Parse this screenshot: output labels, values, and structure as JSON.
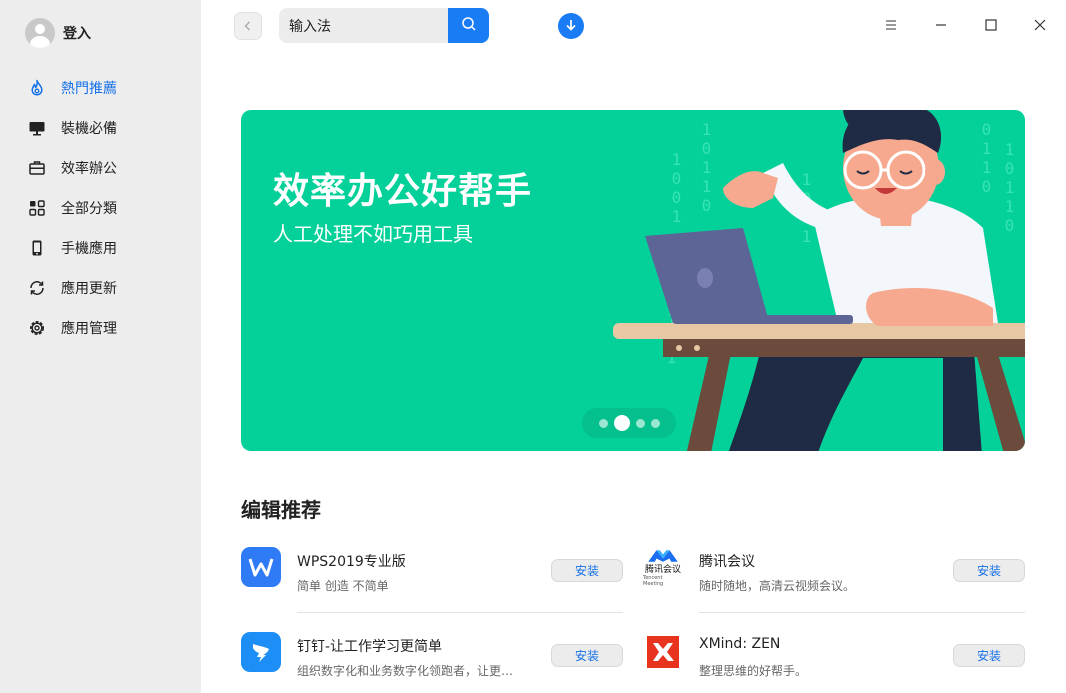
{
  "user": {
    "login_label": "登入"
  },
  "sidebar": {
    "items": [
      {
        "label": "熱門推薦",
        "icon": "flame-icon",
        "active": true
      },
      {
        "label": "裝機必備",
        "icon": "monitor-icon",
        "active": false
      },
      {
        "label": "效率辦公",
        "icon": "briefcase-icon",
        "active": false
      },
      {
        "label": "全部分類",
        "icon": "grid-icon",
        "active": false
      },
      {
        "label": "手機應用",
        "icon": "phone-icon",
        "active": false
      },
      {
        "label": "應用更新",
        "icon": "refresh-icon",
        "active": false
      },
      {
        "label": "應用管理",
        "icon": "settings-icon",
        "active": false
      }
    ]
  },
  "search": {
    "value": "输入法"
  },
  "banner": {
    "title": "效率办公好帮手",
    "subtitle": "人工处理不如巧用工具",
    "slides_total": 4,
    "slide_active": 2
  },
  "section": {
    "title": "编辑推荐",
    "apps": [
      {
        "name": "WPS2019专业版",
        "desc": "简单 创造 不简单",
        "install": "安装",
        "icon": "wps-icon",
        "color": "#2f7bf6"
      },
      {
        "name": "腾讯会议",
        "desc": "随时随地，高清云视频会议。",
        "install": "安装",
        "icon": "tencent-meeting-icon",
        "color": "#1a6cf0",
        "logo_text": "腾讯会议",
        "logo_sub": "Tencent Meeting"
      },
      {
        "name": "钉钉-让工作学习更简单",
        "desc": "组织数字化和业务数字化领跑者，让更…",
        "install": "安装",
        "icon": "dingtalk-icon",
        "color": "#1e8ef7"
      },
      {
        "name": "XMind: ZEN",
        "desc": "整理思维的好帮手。",
        "install": "安装",
        "icon": "xmind-icon",
        "color": "#e8331f"
      }
    ]
  },
  "colors": {
    "accent": "#1a7cf5",
    "banner_bg": "#04d199",
    "sidebar_bg": "#ededed"
  }
}
